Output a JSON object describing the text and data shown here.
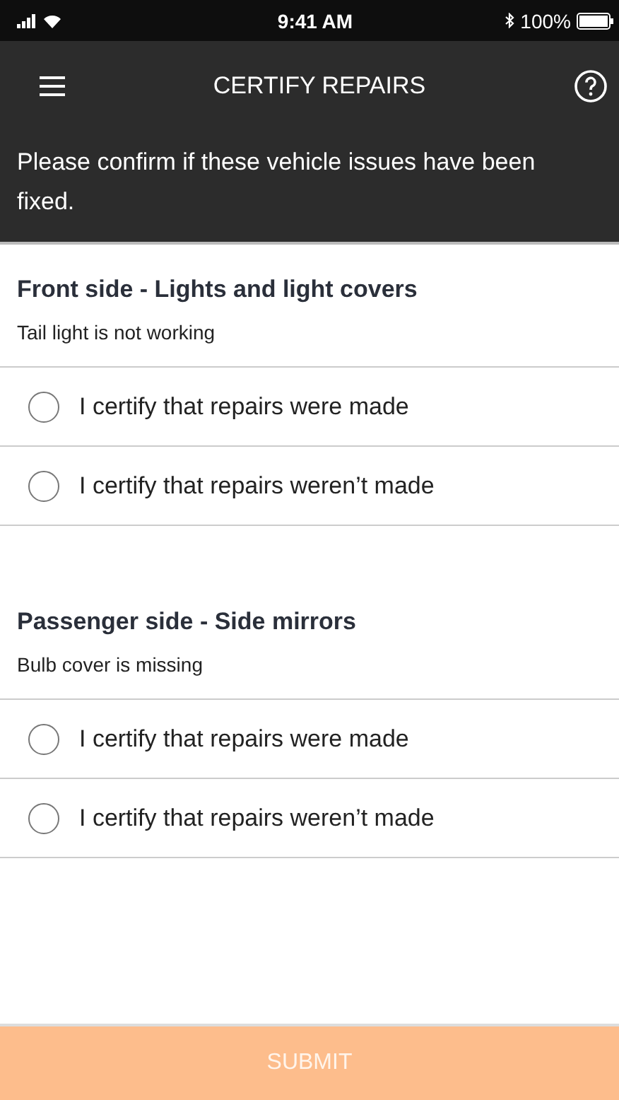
{
  "status_bar": {
    "time": "9:41 AM",
    "battery": "100%"
  },
  "header": {
    "title": "CERTIFY REPAIRS"
  },
  "intro": "Please confirm if these vehicle issues have been fixed.",
  "issues": [
    {
      "title": "Front side - Lights and light covers",
      "detail": "Tail light is not working",
      "options": [
        {
          "label": "I certify that repairs were made",
          "selected": false
        },
        {
          "label": "I certify that repairs weren’t made",
          "selected": false
        }
      ]
    },
    {
      "title": "Passenger side - Side mirrors",
      "detail": "Bulb cover is missing",
      "options": [
        {
          "label": "I certify that repairs were made",
          "selected": false
        },
        {
          "label": "I certify that repairs weren’t made",
          "selected": false
        }
      ]
    }
  ],
  "submit": {
    "label": "SUBMIT",
    "disabled": true
  }
}
